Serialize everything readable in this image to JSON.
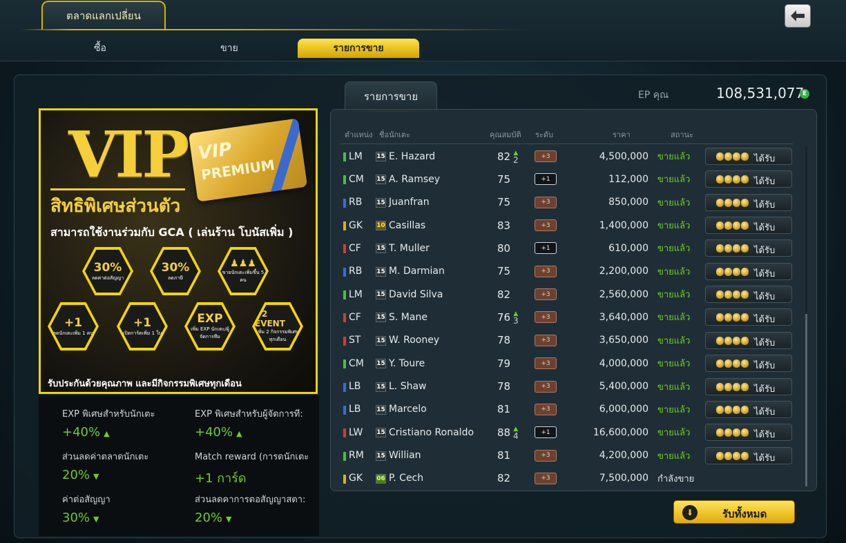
{
  "window": {
    "title": "ตลาดแลกเปลี่ยน"
  },
  "tabs": [
    {
      "label": "ซื้อ",
      "active": false
    },
    {
      "label": "ขาย",
      "active": false
    },
    {
      "label": "รายการขาย",
      "active": true
    }
  ],
  "banner": {
    "vip_text": "VIP",
    "card_line1": "VIP",
    "card_line2": "PREMIUM",
    "subtitle": "สิทธิพิเศษส่วนตัว",
    "gca_line": "สามารถใช้งานร่วมกับ GCA ( เล่นร้าน โบนัสเพิ่ม )",
    "benefits": [
      {
        "big": "30%",
        "small": "ลดค่าต่อสัญญา"
      },
      {
        "big": "30%",
        "small": "ลดภาษี"
      },
      {
        "big": "",
        "small": "ขายนักเตะเพิ่มขึ้น 5 คน"
      },
      {
        "big": "+1",
        "small": "ลดนักเตะเพิ่ม 1 คน"
      },
      {
        "big": "+1",
        "small": "เปิดการ์ดเพิ่ม 1 ใบ"
      },
      {
        "big": "EXP",
        "small": "เพิ่ม EXP นักเตะ/ผู้จัดการทีม"
      },
      {
        "big": "+2 EVENT",
        "small": "เพิ่ม 2 กิจกรรมพิเศษทุกเดือน"
      }
    ],
    "footer": "รับประกันด้วยคุณภาพ และมีกิจกรรมพิเศษทุกเดือน"
  },
  "stats": [
    {
      "label": "EXP พิเศษสำหรับนักเตะ",
      "value": "+40%",
      "arrow": "▲"
    },
    {
      "label": "EXP พิเศษสำหรับผู้จัดการที:",
      "value": "+40%",
      "arrow": "▲"
    },
    {
      "label": "ส่วนลดค่าตลาดนักเตะ",
      "value": "20%",
      "arrow": "▼"
    },
    {
      "label": "Match reward (การดนักเตะ",
      "value": "+1 การ์ด",
      "arrow": ""
    },
    {
      "label": "ค่าต่อสัญญา",
      "value": "30%",
      "arrow": "▼"
    },
    {
      "label": "ส่วนลดคาการตอสัญญาสตา:",
      "value": "20%",
      "arrow": "▼"
    }
  ],
  "list": {
    "tab_label": "รายการขาย",
    "ep_label": "EP คุณ",
    "ep_value": "108,531,077",
    "ep_icon": "E",
    "headers": {
      "position": "ตำแหน่ง",
      "name": "ชื่อนักเตะ",
      "ovr": "คุณสมบัติ",
      "grade": "ระดับ",
      "price": "ราคา",
      "status": "สถานะ"
    },
    "claim_label": "ได้รับ",
    "rows": [
      {
        "pos": "LM",
        "pos_color": "#3ec53a",
        "season": "15",
        "name": "E. Hazard",
        "ovr": "82",
        "plus": "2",
        "grade": "+3",
        "grade_style": "brown",
        "price": "4,500,000",
        "status": "ขายแล้ว",
        "claim": true
      },
      {
        "pos": "CM",
        "pos_color": "#3ec53a",
        "season": "15",
        "name": "A. Ramsey",
        "ovr": "75",
        "plus": "",
        "grade": "+1",
        "grade_style": "dark",
        "price": "112,000",
        "status": "ขายแล้ว",
        "claim": true
      },
      {
        "pos": "RB",
        "pos_color": "#2e6fe0",
        "season": "15",
        "name": "Juanfran",
        "ovr": "75",
        "plus": "",
        "grade": "+3",
        "grade_style": "brown",
        "price": "850,000",
        "status": "ขายแล้ว",
        "claim": true
      },
      {
        "pos": "GK",
        "pos_color": "#e0b010",
        "season": "10",
        "name": "Casillas",
        "ovr": "83",
        "plus": "",
        "grade": "+3",
        "grade_style": "brown",
        "price": "1,400,000",
        "status": "ขายแล้ว",
        "claim": true
      },
      {
        "pos": "CF",
        "pos_color": "#d83a2a",
        "season": "15",
        "name": "T. Muller",
        "ovr": "80",
        "plus": "",
        "grade": "+1",
        "grade_style": "dark",
        "price": "610,000",
        "status": "ขายแล้ว",
        "claim": true
      },
      {
        "pos": "RB",
        "pos_color": "#2e6fe0",
        "season": "15",
        "name": "M. Darmian",
        "ovr": "75",
        "plus": "",
        "grade": "+3",
        "grade_style": "brown",
        "price": "2,200,000",
        "status": "ขายแล้ว",
        "claim": true
      },
      {
        "pos": "LM",
        "pos_color": "#3ec53a",
        "season": "15",
        "name": "David Silva",
        "ovr": "82",
        "plus": "",
        "grade": "+3",
        "grade_style": "brown",
        "price": "2,560,000",
        "status": "ขายแล้ว",
        "claim": true
      },
      {
        "pos": "CF",
        "pos_color": "#d83a2a",
        "season": "15",
        "name": "S. Mane",
        "ovr": "76",
        "plus": "3",
        "grade": "+3",
        "grade_style": "brown",
        "price": "3,640,000",
        "status": "ขายแล้ว",
        "claim": true
      },
      {
        "pos": "ST",
        "pos_color": "#d83a2a",
        "season": "15",
        "name": "W. Rooney",
        "ovr": "78",
        "plus": "",
        "grade": "+3",
        "grade_style": "brown",
        "price": "3,650,000",
        "status": "ขายแล้ว",
        "claim": true
      },
      {
        "pos": "CM",
        "pos_color": "#3ec53a",
        "season": "15",
        "name": "Y. Toure",
        "ovr": "79",
        "plus": "",
        "grade": "+3",
        "grade_style": "brown",
        "price": "4,000,000",
        "status": "ขายแล้ว",
        "claim": true
      },
      {
        "pos": "LB",
        "pos_color": "#2e6fe0",
        "season": "15",
        "name": "L. Shaw",
        "ovr": "78",
        "plus": "",
        "grade": "+3",
        "grade_style": "brown",
        "price": "5,400,000",
        "status": "ขายแล้ว",
        "claim": true
      },
      {
        "pos": "LB",
        "pos_color": "#2e6fe0",
        "season": "15",
        "name": "Marcelo",
        "ovr": "81",
        "plus": "",
        "grade": "+3",
        "grade_style": "brown",
        "price": "6,000,000",
        "status": "ขายแล้ว",
        "claim": true
      },
      {
        "pos": "LW",
        "pos_color": "#d83a2a",
        "season": "15",
        "name": "Cristiano Ronaldo",
        "ovr": "88",
        "plus": "4",
        "grade": "+1",
        "grade_style": "dark",
        "price": "16,600,000",
        "status": "ขายแล้ว",
        "claim": true
      },
      {
        "pos": "RM",
        "pos_color": "#3ec53a",
        "season": "15",
        "name": "Willian",
        "ovr": "81",
        "plus": "",
        "grade": "+3",
        "grade_style": "brown",
        "price": "4,200,000",
        "status": "ขายแล้ว",
        "claim": true
      },
      {
        "pos": "GK",
        "pos_color": "#e0b010",
        "season": "06",
        "name": "P. Cech",
        "ovr": "82",
        "plus": "",
        "grade": "+3",
        "grade_style": "brown",
        "price": "7,500,000",
        "status": "กำลังขาย",
        "claim": false
      }
    ],
    "claim_all_label": "รับทั้งหมด"
  }
}
